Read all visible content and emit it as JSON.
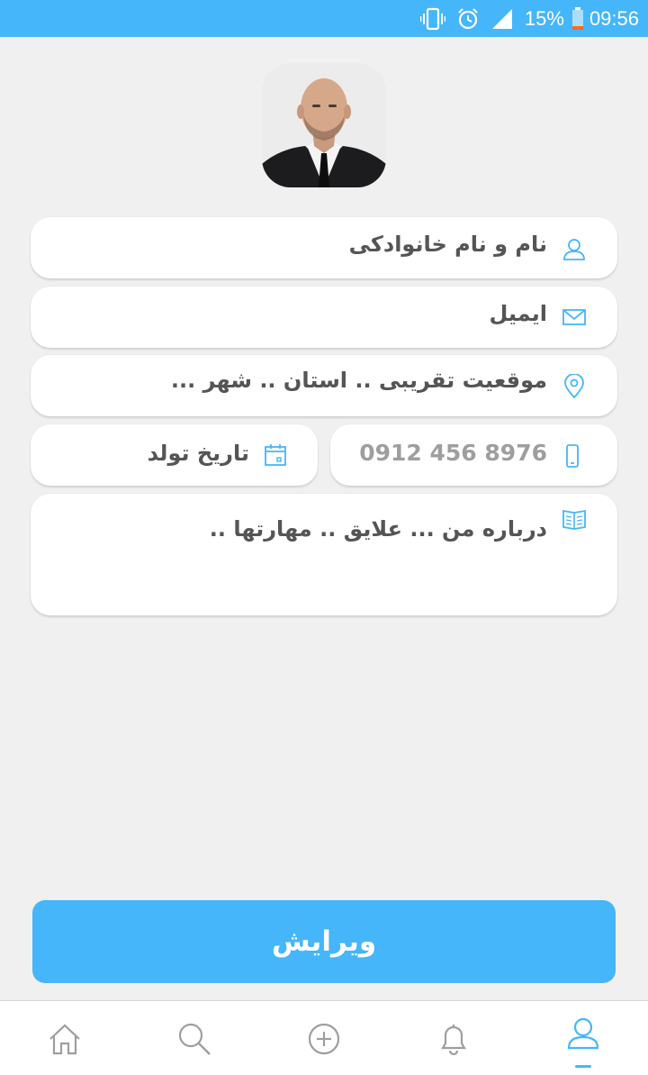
{
  "status_bar": {
    "battery_percent": "15%",
    "time": "09:56",
    "icons": [
      "vibrate-icon",
      "alarm-icon",
      "signal-icon",
      "battery-icon"
    ]
  },
  "profile": {
    "avatar": "profile-photo"
  },
  "form": {
    "full_name_placeholder": "نام و نام خانوادکی",
    "email_placeholder": "ایمیل",
    "location_placeholder": "موقعیت تقریبی .. استان .. شهر ...",
    "phone_placeholder": "0912 456 8976",
    "birthdate_placeholder": "تاریخ تولد",
    "about_placeholder": "درباره من ... علایق .. مهارتها .."
  },
  "actions": {
    "edit_label": "ویرایش"
  },
  "bottom_nav": {
    "items": [
      "home",
      "search",
      "add",
      "notifications",
      "profile"
    ],
    "active": "profile"
  },
  "colors": {
    "accent": "#45b6f9",
    "background": "#f0f0f0",
    "card": "#ffffff",
    "text": "#555555",
    "placeholder": "#9e9e9e",
    "nav_icon": "#9e9e9e"
  }
}
